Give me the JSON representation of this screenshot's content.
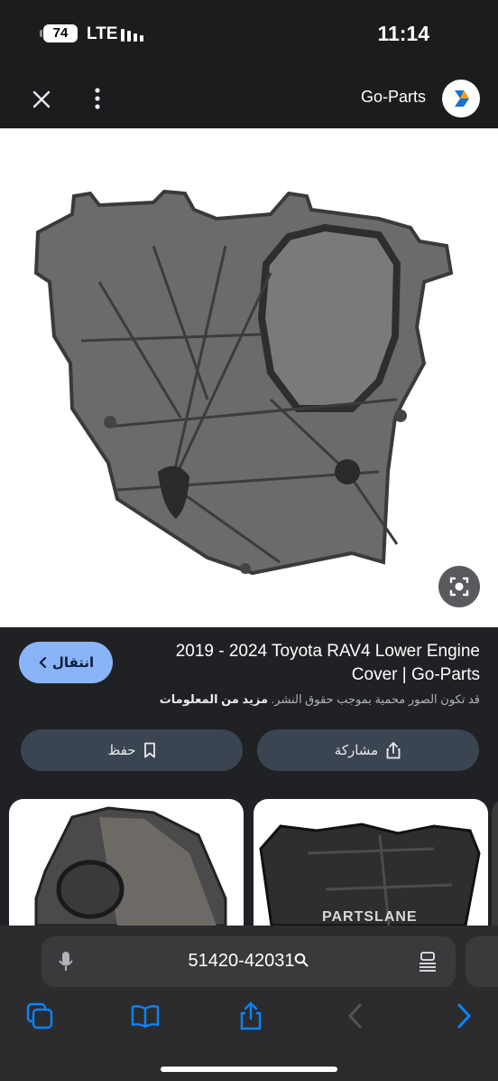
{
  "status_bar": {
    "battery": "74",
    "network": "LTE",
    "time": "11:14"
  },
  "header": {
    "site_name": "Go-Parts",
    "icons": [
      "close-icon",
      "more-vertical-icon",
      "go-parts-logo"
    ]
  },
  "image_panel": {
    "lens_icon": "google-lens-icon"
  },
  "result": {
    "visit_label": "انتقال",
    "title": "2019 - 2024 Toyota RAV4 Lower Engine Cover | Go-Parts",
    "copyright_notice": "قد تكون الصور محمية بموجب حقوق النشر.",
    "learn_more": "مزيد من المعلومات",
    "save_label": "حفظ",
    "share_label": "مشاركة"
  },
  "related": {
    "watermark": "PARTSLANE"
  },
  "browser": {
    "address": "51420-42031",
    "icons": [
      "microphone-icon",
      "search-icon",
      "reader-icon",
      "tabs-icon",
      "bookmarks-icon",
      "share-icon",
      "back-icon",
      "forward-icon"
    ]
  },
  "colors": {
    "accent": "#8ab4f8",
    "forward": "#0a84ff",
    "background": "#202124"
  }
}
